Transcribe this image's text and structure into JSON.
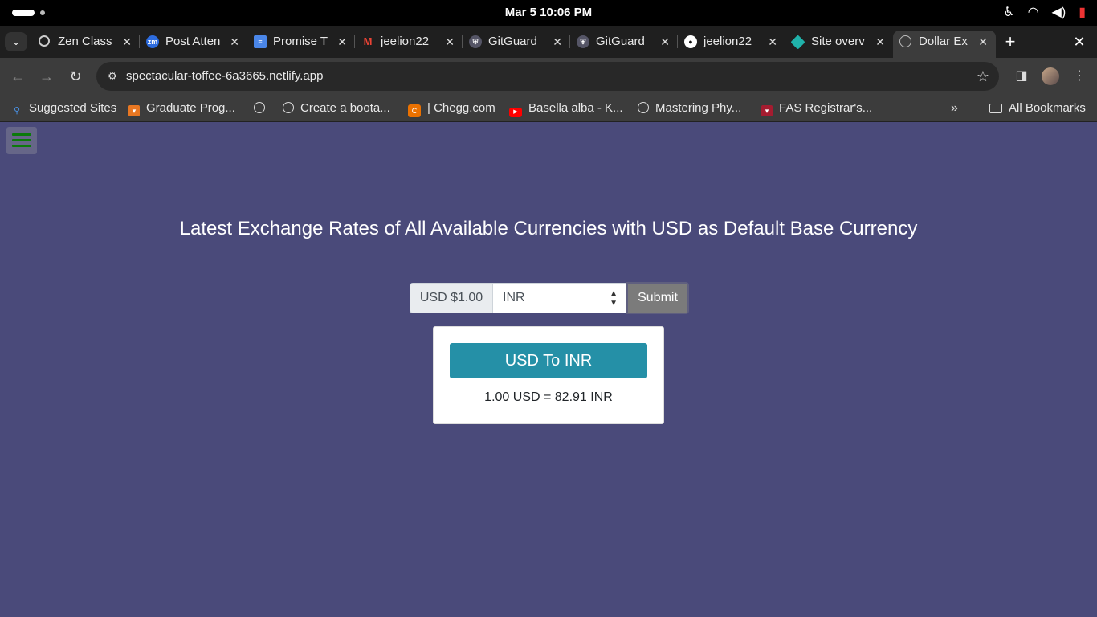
{
  "os": {
    "clock": "Mar 5  10:06 PM"
  },
  "tabs": [
    {
      "label": "Zen Class",
      "icon": "loading-icon"
    },
    {
      "label": "Post Atten",
      "icon": "zoom-icon"
    },
    {
      "label": "Promise T",
      "icon": "docs-icon"
    },
    {
      "label": "jeelion22",
      "icon": "gmail-icon"
    },
    {
      "label": "GitGuard",
      "icon": "gitguardian-icon"
    },
    {
      "label": "GitGuard",
      "icon": "gitguardian-icon"
    },
    {
      "label": "jeelion22",
      "icon": "github-icon"
    },
    {
      "label": "Site overv",
      "icon": "netlify-icon"
    },
    {
      "label": "Dollar Ex",
      "icon": "globe-icon",
      "active": true
    }
  ],
  "toolbar": {
    "url": "spectacular-toffee-6a3665.netlify.app"
  },
  "bookmarks": {
    "items": [
      {
        "label": "Suggested Sites"
      },
      {
        "label": "Graduate Prog..."
      },
      {
        "label": ""
      },
      {
        "label": "Create a boota..."
      },
      {
        "label": "| Chegg.com"
      },
      {
        "label": "Basella alba - K..."
      },
      {
        "label": "Mastering Phy..."
      },
      {
        "label": "FAS Registrar's..."
      }
    ],
    "all_bookmarks": "All Bookmarks"
  },
  "page": {
    "heading": "Latest Exchange Rates of All Available Currencies with USD as Default Base Currency",
    "converter": {
      "amount": "USD $1.00",
      "selected_currency": "INR",
      "submit_label": "Submit"
    },
    "result": {
      "title": "USD To INR",
      "text": "1.00 USD = 82.91 INR"
    }
  },
  "colors": {
    "page_background": "#4a4a7a",
    "result_title_bg": "#2590a7",
    "submit_bg": "#7b7b7b",
    "menu_lines": "#0b7a0b"
  }
}
